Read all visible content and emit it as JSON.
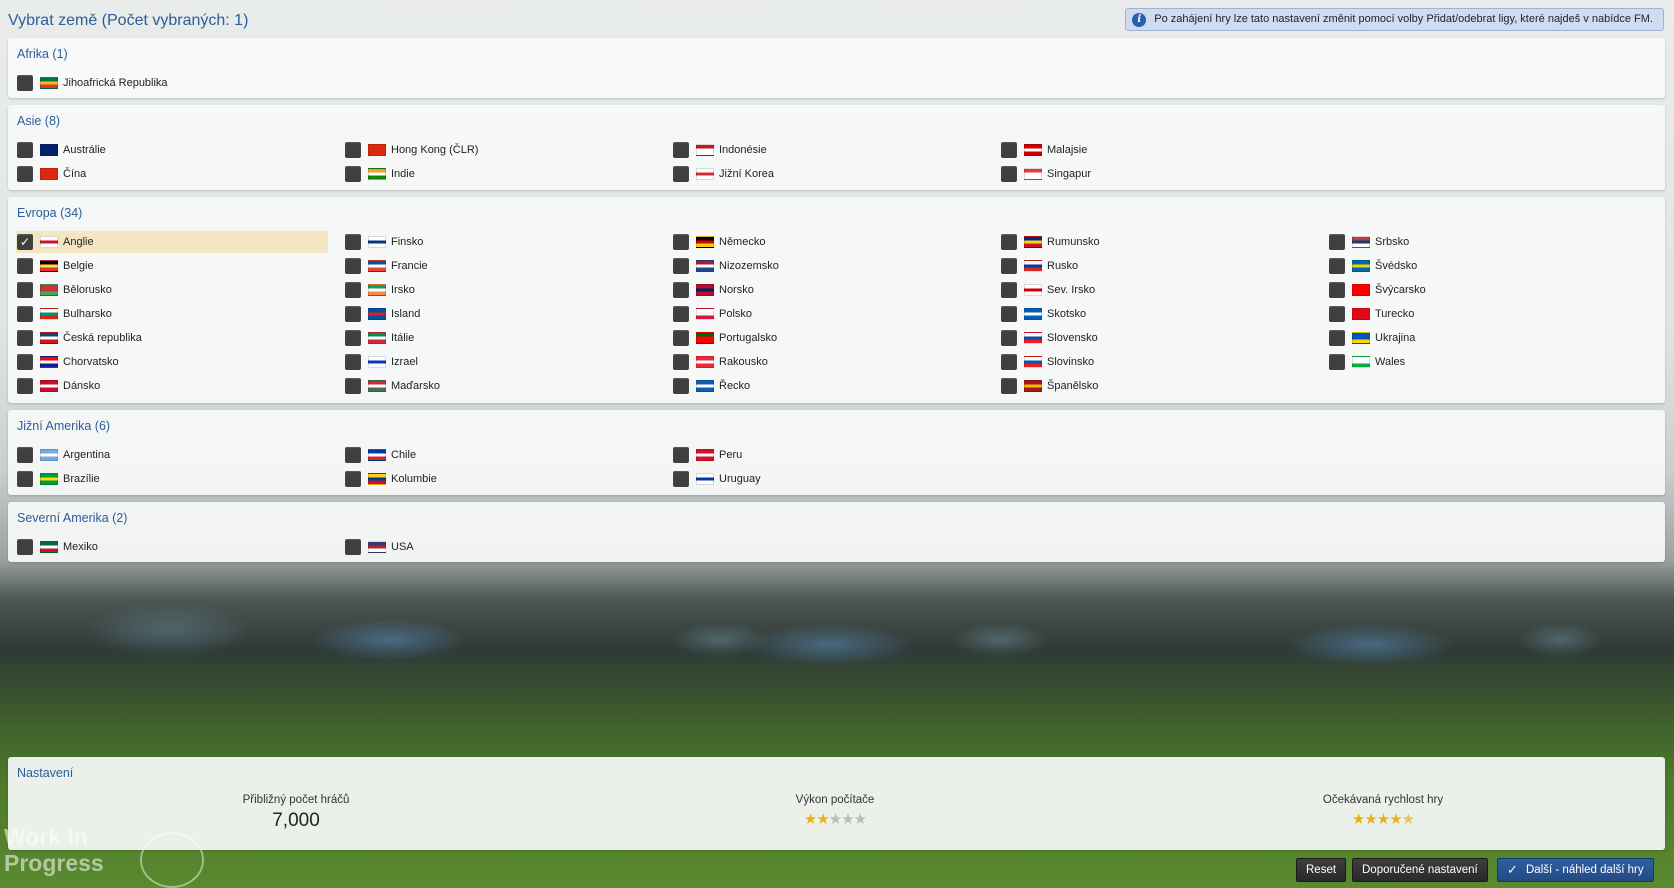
{
  "title": "Vybrat země (Počet vybraných: 1)",
  "info_text": "Po zahájení hry lze tato nastavení změnit pomocí volby Přidat/odebrat ligy, které najdeš v nabídce FM.",
  "regions": [
    {
      "title": "Afrika (1)",
      "countries": [
        {
          "name": "Jihoafrická Republika",
          "checked": false,
          "flag": [
            "#007749",
            "#ffb81c",
            "#de3831"
          ]
        }
      ]
    },
    {
      "title": "Asie (8)",
      "countries": [
        {
          "name": "Austrálie",
          "checked": false,
          "flag": [
            "#012169",
            "#012169",
            "#012169"
          ]
        },
        {
          "name": "Čína",
          "checked": false,
          "flag": [
            "#de2910",
            "#de2910",
            "#de2910"
          ]
        },
        {
          "name": "Hong Kong (ČLR)",
          "checked": false,
          "flag": [
            "#de2910",
            "#de2910",
            "#de2910"
          ]
        },
        {
          "name": "Indie",
          "checked": false,
          "flag": [
            "#ff9933",
            "#ffffff",
            "#138808"
          ]
        },
        {
          "name": "Indonésie",
          "checked": false,
          "flag": [
            "#ce1126",
            "#ffffff",
            "#ffffff"
          ]
        },
        {
          "name": "Jižní Korea",
          "checked": false,
          "flag": [
            "#ffffff",
            "#cd2e3a",
            "#ffffff"
          ]
        },
        {
          "name": "Malajsie",
          "checked": false,
          "flag": [
            "#cc0001",
            "#ffffff",
            "#cc0001"
          ]
        },
        {
          "name": "Singapur",
          "checked": false,
          "flag": [
            "#ef3340",
            "#ffffff",
            "#ffffff"
          ]
        }
      ]
    },
    {
      "title": "Evropa (34)",
      "countries": [
        {
          "name": "Anglie",
          "checked": true,
          "flag": [
            "#ffffff",
            "#ce1124",
            "#ffffff"
          ]
        },
        {
          "name": "Belgie",
          "checked": false,
          "flag": [
            "#000000",
            "#fae042",
            "#ed2939"
          ]
        },
        {
          "name": "Bělorusko",
          "checked": false,
          "flag": [
            "#c8313e",
            "#c8313e",
            "#4aa657"
          ]
        },
        {
          "name": "Bulharsko",
          "checked": false,
          "flag": [
            "#ffffff",
            "#00966e",
            "#d62612"
          ]
        },
        {
          "name": "Česká republika",
          "checked": false,
          "flag": [
            "#11457e",
            "#ffffff",
            "#d7141a"
          ]
        },
        {
          "name": "Chorvatsko",
          "checked": false,
          "flag": [
            "#ff0000",
            "#ffffff",
            "#171796"
          ]
        },
        {
          "name": "Dánsko",
          "checked": false,
          "flag": [
            "#c60c30",
            "#ffffff",
            "#c60c30"
          ]
        },
        {
          "name": "Finsko",
          "checked": false,
          "flag": [
            "#ffffff",
            "#003580",
            "#ffffff"
          ]
        },
        {
          "name": "Francie",
          "checked": false,
          "flag": [
            "#0055a4",
            "#ffffff",
            "#ef4135"
          ]
        },
        {
          "name": "Irsko",
          "checked": false,
          "flag": [
            "#169b62",
            "#ffffff",
            "#ff883e"
          ]
        },
        {
          "name": "Island",
          "checked": false,
          "flag": [
            "#02529c",
            "#dc1e35",
            "#02529c"
          ]
        },
        {
          "name": "Itálie",
          "checked": false,
          "flag": [
            "#009246",
            "#ffffff",
            "#ce2b37"
          ]
        },
        {
          "name": "Izrael",
          "checked": false,
          "flag": [
            "#ffffff",
            "#0038b8",
            "#ffffff"
          ]
        },
        {
          "name": "Maďarsko",
          "checked": false,
          "flag": [
            "#ce2939",
            "#ffffff",
            "#477050"
          ]
        },
        {
          "name": "Německo",
          "checked": false,
          "flag": [
            "#000000",
            "#dd0000",
            "#ffce00"
          ]
        },
        {
          "name": "Nizozemsko",
          "checked": false,
          "flag": [
            "#ae1c28",
            "#ffffff",
            "#21468b"
          ]
        },
        {
          "name": "Norsko",
          "checked": false,
          "flag": [
            "#ba0c2f",
            "#00205b",
            "#ba0c2f"
          ]
        },
        {
          "name": "Polsko",
          "checked": false,
          "flag": [
            "#ffffff",
            "#ffffff",
            "#dc143c"
          ]
        },
        {
          "name": "Portugalsko",
          "checked": false,
          "flag": [
            "#006600",
            "#ff0000",
            "#ff0000"
          ]
        },
        {
          "name": "Rakousko",
          "checked": false,
          "flag": [
            "#ed2939",
            "#ffffff",
            "#ed2939"
          ]
        },
        {
          "name": "Řecko",
          "checked": false,
          "flag": [
            "#0d5eaf",
            "#ffffff",
            "#0d5eaf"
          ]
        },
        {
          "name": "Rumunsko",
          "checked": false,
          "flag": [
            "#002b7f",
            "#fcd116",
            "#ce1126"
          ]
        },
        {
          "name": "Rusko",
          "checked": false,
          "flag": [
            "#ffffff",
            "#0039a6",
            "#d52b1e"
          ]
        },
        {
          "name": "Sev. Irsko",
          "checked": false,
          "flag": [
            "#ffffff",
            "#cc0000",
            "#ffffff"
          ]
        },
        {
          "name": "Skotsko",
          "checked": false,
          "flag": [
            "#005eb8",
            "#ffffff",
            "#005eb8"
          ]
        },
        {
          "name": "Slovensko",
          "checked": false,
          "flag": [
            "#ffffff",
            "#0b4ea2",
            "#ee1c25"
          ]
        },
        {
          "name": "Slovinsko",
          "checked": false,
          "flag": [
            "#ffffff",
            "#005da4",
            "#ed1c24"
          ]
        },
        {
          "name": "Španělsko",
          "checked": false,
          "flag": [
            "#aa151b",
            "#f1bf00",
            "#aa151b"
          ]
        },
        {
          "name": "Srbsko",
          "checked": false,
          "flag": [
            "#c6363c",
            "#0c4076",
            "#ffffff"
          ]
        },
        {
          "name": "Švédsko",
          "checked": false,
          "flag": [
            "#006aa7",
            "#fecc00",
            "#006aa7"
          ]
        },
        {
          "name": "Švýcarsko",
          "checked": false,
          "flag": [
            "#ff0000",
            "#ff0000",
            "#ff0000"
          ]
        },
        {
          "name": "Turecko",
          "checked": false,
          "flag": [
            "#e30a17",
            "#e30a17",
            "#e30a17"
          ]
        },
        {
          "name": "Ukrajina",
          "checked": false,
          "flag": [
            "#0057b7",
            "#0057b7",
            "#ffd700"
          ]
        },
        {
          "name": "Wales",
          "checked": false,
          "flag": [
            "#ffffff",
            "#ffffff",
            "#00b140"
          ]
        }
      ]
    },
    {
      "title": "Jižní Amerika (6)",
      "countries": [
        {
          "name": "Argentina",
          "checked": false,
          "flag": [
            "#74acdf",
            "#ffffff",
            "#74acdf"
          ]
        },
        {
          "name": "Brazílie",
          "checked": false,
          "flag": [
            "#009c3b",
            "#ffdf00",
            "#009c3b"
          ]
        },
        {
          "name": "Chile",
          "checked": false,
          "flag": [
            "#0039a6",
            "#ffffff",
            "#d52b1e"
          ]
        },
        {
          "name": "Kolumbie",
          "checked": false,
          "flag": [
            "#fcd116",
            "#003893",
            "#ce1126"
          ]
        },
        {
          "name": "Peru",
          "checked": false,
          "flag": [
            "#d91023",
            "#ffffff",
            "#d91023"
          ]
        },
        {
          "name": "Uruguay",
          "checked": false,
          "flag": [
            "#ffffff",
            "#0038a8",
            "#ffffff"
          ]
        }
      ]
    },
    {
      "title": "Severní Amerika (2)",
      "countries": [
        {
          "name": "Mexiko",
          "checked": false,
          "flag": [
            "#006847",
            "#ffffff",
            "#ce1126"
          ]
        },
        {
          "name": "USA",
          "checked": false,
          "flag": [
            "#3c3b6e",
            "#b22234",
            "#ffffff"
          ]
        }
      ]
    }
  ],
  "settings": {
    "title": "Nastavení",
    "players_label": "Přibližný počet hráčů",
    "players_value": "7,000",
    "performance_label": "Výkon počítače",
    "performance_stars": 2,
    "speed_label": "Očekávaná rychlost hry",
    "speed_stars": 4.5
  },
  "buttons": {
    "reset": "Reset",
    "recommended": "Doporučené nastavení",
    "next": "Další - náhled další hry"
  },
  "watermark": {
    "line1": "Work In",
    "line2": "Progress"
  },
  "colors": {
    "accent": "#2c5d9c",
    "selected_row": "#f5e6c3",
    "star": "#e8b315"
  }
}
